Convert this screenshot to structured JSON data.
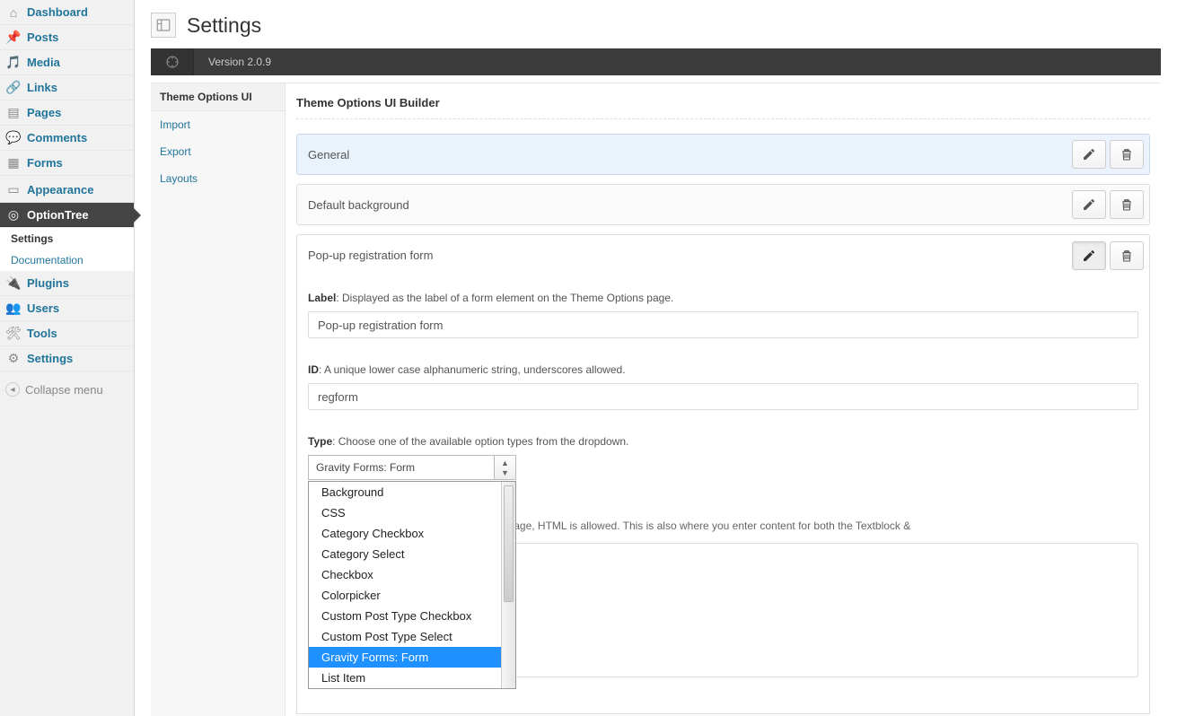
{
  "page_title": "Settings",
  "version_label": "Version 2.0.9",
  "admin_menu": {
    "dashboard": "Dashboard",
    "posts": "Posts",
    "media": "Media",
    "links": "Links",
    "pages": "Pages",
    "comments": "Comments",
    "forms": "Forms",
    "appearance": "Appearance",
    "optiontree": "OptionTree",
    "option_sub": {
      "settings": "Settings",
      "documentation": "Documentation"
    },
    "plugins": "Plugins",
    "users": "Users",
    "tools": "Tools",
    "settings": "Settings",
    "collapse": "Collapse menu"
  },
  "subnav": {
    "group_label": "Theme Options UI",
    "import": "Import",
    "export": "Export",
    "layouts": "Layouts"
  },
  "builder": {
    "heading": "Theme Options UI Builder",
    "rows": {
      "general": "General",
      "default_bg": "Default background",
      "popup": "Pop-up registration form"
    },
    "label_field": {
      "name": "Label",
      "desc": ": Displayed as the label of a form element on the Theme Options page.",
      "value": "Pop-up registration form"
    },
    "id_field": {
      "name": "ID",
      "desc": ": A unique lower case alphanumeric string, underscores allowed.",
      "value": "regform"
    },
    "type_field": {
      "name": "Type",
      "desc": ": Choose one of the available option types from the dropdown.",
      "selected": "Gravity Forms: Form",
      "options": [
        "Background",
        "CSS",
        "Category Checkbox",
        "Category Select",
        "Checkbox",
        "Colorpicker",
        "Custom Post Type Checkbox",
        "Custom Post Type Select",
        "Gravity Forms: Form",
        "List Item"
      ]
    },
    "desc_trail": "r the users to read on the Theme Options page, HTML is allowed. This is also where you enter content for both the Textblock &"
  }
}
